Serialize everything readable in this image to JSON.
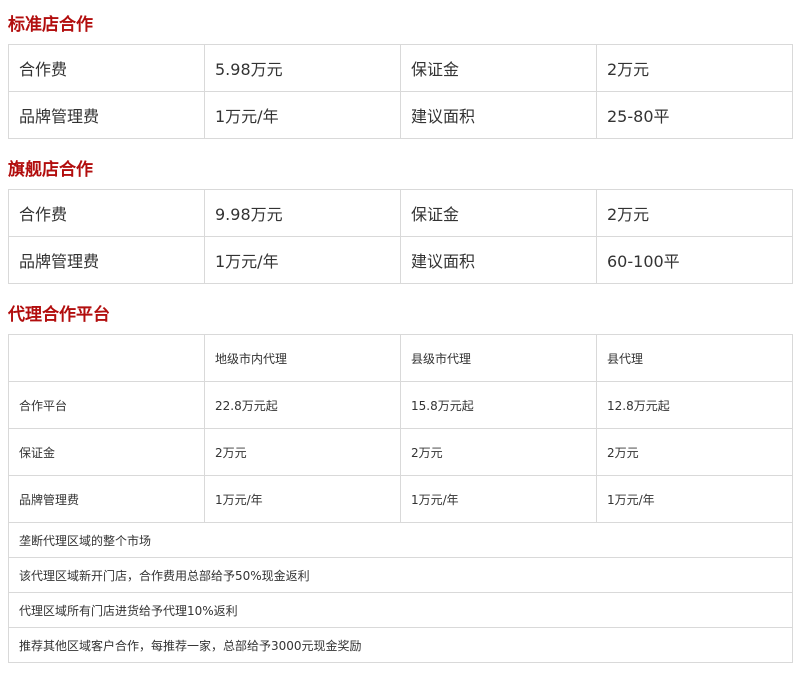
{
  "standard": {
    "title": "标准店合作",
    "rows": [
      [
        "合作费",
        "5.98万元",
        "保证金",
        "2万元"
      ],
      [
        "品牌管理费",
        "1万元/年",
        "建议面积",
        "25-80平"
      ]
    ]
  },
  "flagship": {
    "title": "旗舰店合作",
    "rows": [
      [
        "合作费",
        "9.98万元",
        "保证金",
        "2万元"
      ],
      [
        "品牌管理费",
        "1万元/年",
        "建议面积",
        "60-100平"
      ]
    ]
  },
  "agent": {
    "title": "代理合作平台",
    "headers": [
      "",
      "地级市内代理",
      "县级市代理",
      "县代理"
    ],
    "rows": [
      [
        "合作平台",
        "22.8万元起",
        "15.8万元起",
        "12.8万元起"
      ],
      [
        "保证金",
        "2万元",
        "2万元",
        "2万元"
      ],
      [
        "品牌管理费",
        "1万元/年",
        "1万元/年",
        "1万元/年"
      ]
    ],
    "notes": [
      "垄断代理区域的整个市场",
      "该代理区域新开门店，合作费用总部给予50%现金返利",
      "代理区域所有门店进货给予代理10%返利",
      "推荐其他区域客户合作，每推荐一家，总部给予3000元现金奖励"
    ]
  }
}
